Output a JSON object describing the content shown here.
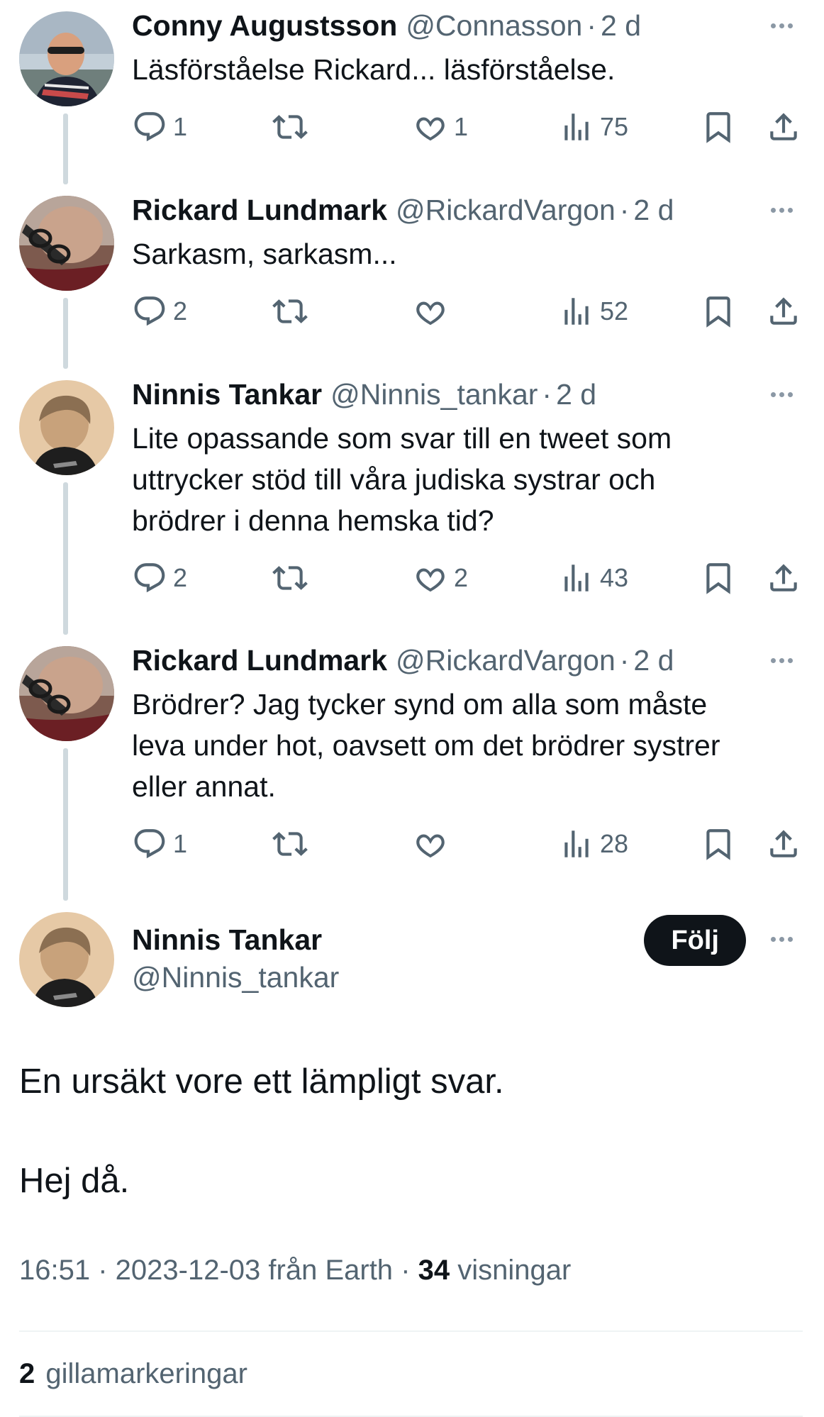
{
  "thread": [
    {
      "name": "Conny Augustsson",
      "handle": "@Connasson",
      "time": "2 d",
      "text": "Läsförståelse Rickard... läsförståelse.",
      "replies": "1",
      "retweets": "",
      "likes": "1",
      "views": "75"
    },
    {
      "name": "Rickard Lundmark",
      "handle": "@RickardVargon",
      "time": "2 d",
      "text": "Sarkasm, sarkasm...",
      "replies": "2",
      "retweets": "",
      "likes": "",
      "views": "52"
    },
    {
      "name": "Ninnis Tankar",
      "handle": "@Ninnis_tankar",
      "time": "2 d",
      "text": "Lite opassande som svar till en tweet som\nuttrycker stöd till våra judiska systrar och\nbrödrer i denna hemska tid?",
      "replies": "2",
      "retweets": "",
      "likes": "2",
      "views": "43"
    },
    {
      "name": "Rickard Lundmark",
      "handle": "@RickardVargon",
      "time": "2 d",
      "text": "Brödrer? Jag tycker synd om alla som måste\nleva under hot, oavsett om det brödrer systrer\neller annat.",
      "replies": "1",
      "retweets": "",
      "likes": "",
      "views": "28"
    }
  ],
  "main": {
    "name": "Ninnis Tankar",
    "handle": "@Ninnis_tankar",
    "follow_label": "Följ",
    "text_line1": "En ursäkt vore ett lämpligt svar.",
    "text_line2": "Hej då.",
    "time": "16:51",
    "date": "2023-12-03",
    "source": "från Earth",
    "views": "34",
    "views_label": "visningar",
    "likes": "2",
    "likes_label": "gillamarkeringar"
  },
  "icons": {
    "reply": "reply-icon",
    "retweet": "retweet-icon",
    "like": "heart-icon",
    "views": "views-icon",
    "bookmark": "bookmark-icon",
    "share": "share-icon",
    "more": "more-icon"
  },
  "colors": {
    "text": "#0f1419",
    "muted": "#536471",
    "line": "#cfd9de",
    "follow_bg": "#0f1419"
  }
}
